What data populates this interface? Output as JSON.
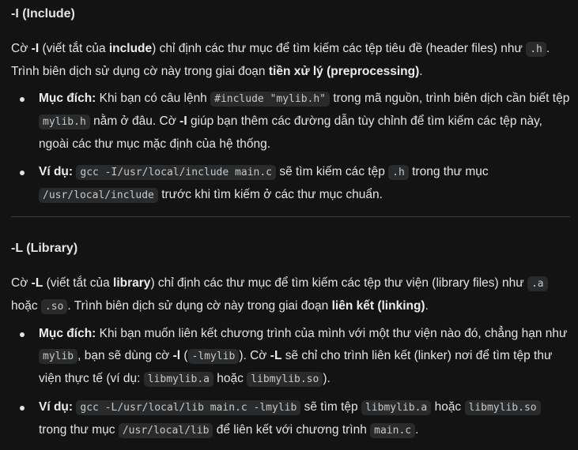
{
  "include": {
    "title": "-I (Include)",
    "intro": {
      "t1": "Cờ ",
      "flag": "-I",
      "t2": " (viết tắt của ",
      "word": "include",
      "t3": ") chỉ định các thư mục để tìm kiếm các tệp tiêu đề (header files) như ",
      "code_h": ".h",
      "t4": ". Trình biên dịch sử dụng cờ này trong giai đoạn ",
      "stage": "tiền xử lý (preprocessing)",
      "t5": "."
    },
    "purpose": {
      "label": "Mục đích:",
      "t1": " Khi bạn có câu lệnh ",
      "code_include": "#include \"mylib.h\"",
      "t2": " trong mã nguồn, trình biên dịch cần biết tệp ",
      "code_file": "mylib.h",
      "t3": " nằm ở đâu. Cờ ",
      "flag": "-I",
      "t4": " giúp bạn thêm các đường dẫn tùy chỉnh để tìm kiếm các tệp này, ngoài các thư mục mặc định của hệ thống."
    },
    "example": {
      "label": "Ví dụ:",
      "code_cmd": "gcc -I/usr/local/include main.c",
      "t1": " sẽ tìm kiếm các tệp ",
      "code_h": ".h",
      "t2": " trong thư mục ",
      "code_dir": "/usr/local/include",
      "t3": " trước khi tìm kiếm ở các thư mục chuẩn."
    }
  },
  "library": {
    "title": "-L (Library)",
    "intro": {
      "t1": "Cờ ",
      "flag": "-L",
      "t2": " (viết tắt của ",
      "word": "library",
      "t3": ") chỉ định các thư mục để tìm kiếm các tệp thư viện (library files) như ",
      "code_a": ".a",
      "t4": " hoặc ",
      "code_so": ".so",
      "t5": ". Trình biên dịch sử dụng cờ này trong giai đoạn ",
      "stage": "liên kết (linking)",
      "t6": "."
    },
    "purpose": {
      "label": "Mục đích:",
      "t1": " Khi bạn muốn liên kết chương trình của mình với một thư viện nào đó, chẳng hạn như ",
      "code_lib": "mylib",
      "t2": ", bạn sẽ dùng cờ ",
      "flag_l": "-l",
      "t3": " (",
      "code_lmylib": "-lmylib",
      "t4": "). Cờ ",
      "flag_L": "-L",
      "t5": " sẽ chỉ cho trình liên kết (linker) nơi để tìm tệp thư viện thực tế (ví dụ: ",
      "code_a": "libmylib.a",
      "t6": " hoặc ",
      "code_so": "libmylib.so",
      "t7": ")."
    },
    "example": {
      "label": "Ví dụ:",
      "code_cmd": "gcc -L/usr/local/lib main.c -lmylib",
      "t1": " sẽ tìm tệp ",
      "code_a": "libmylib.a",
      "t2": " hoặc ",
      "code_so": "libmylib.so",
      "t3": " trong thư mục ",
      "code_dir": "/usr/local/lib",
      "t4": " để liên kết với chương trình ",
      "code_main": "main.c",
      "t5": "."
    }
  }
}
